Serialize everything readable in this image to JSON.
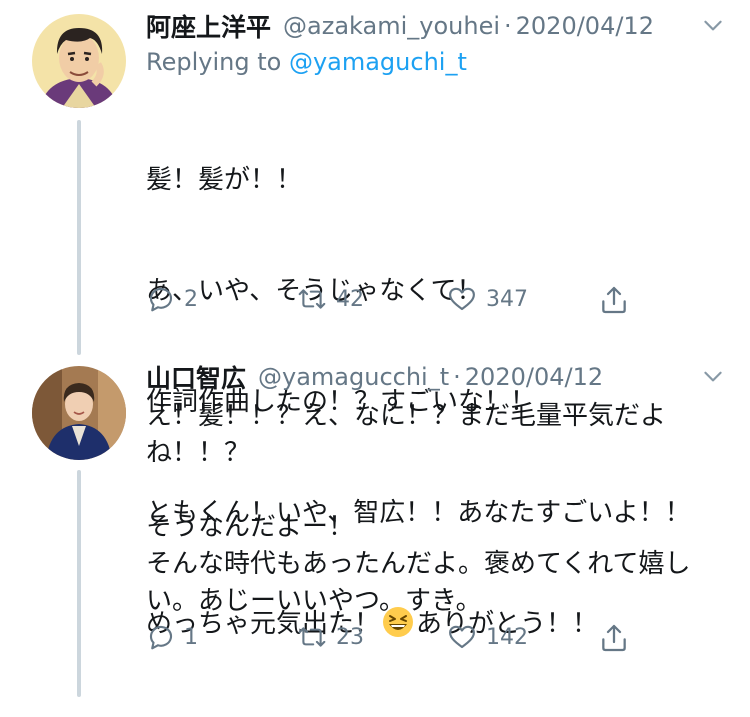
{
  "tweets": [
    {
      "name": "阿座上洋平",
      "handle": "@azakami_youhei",
      "sep": "·",
      "date": "2020/04/12",
      "replying_prefix": "Replying to ",
      "replying_handle": "@yamaguchi_t",
      "lines": [
        "髪！髪が！！",
        "あ、いや、そうじゃなくて！",
        "作詞作曲したの！？すごいな！！",
        "ともくん！いや、智広！！あなたすごいよ！！",
        "めっちゃ元気出た！",
        "ありがとう！！"
      ],
      "emoji": "grinning-squinting-face",
      "replies": "2",
      "retweets": "42",
      "likes": "347"
    },
    {
      "name": "山口智広",
      "handle": "@yamagucchi_t",
      "sep": "·",
      "date": "2020/04/12",
      "text": "え！髪！！？え、なに！？まだ毛量平気だよね！！？\n\nそうなんだよー！\nそんな時代もあったんだよ。褒めてくれて嬉しい。あじーいいやつ。すき。",
      "replies": "1",
      "retweets": "23",
      "likes": "142"
    }
  ],
  "colors": {
    "text": "#14171a",
    "secondary": "#657786",
    "link": "#1da1f2",
    "thread_line": "#ccd6dd"
  }
}
